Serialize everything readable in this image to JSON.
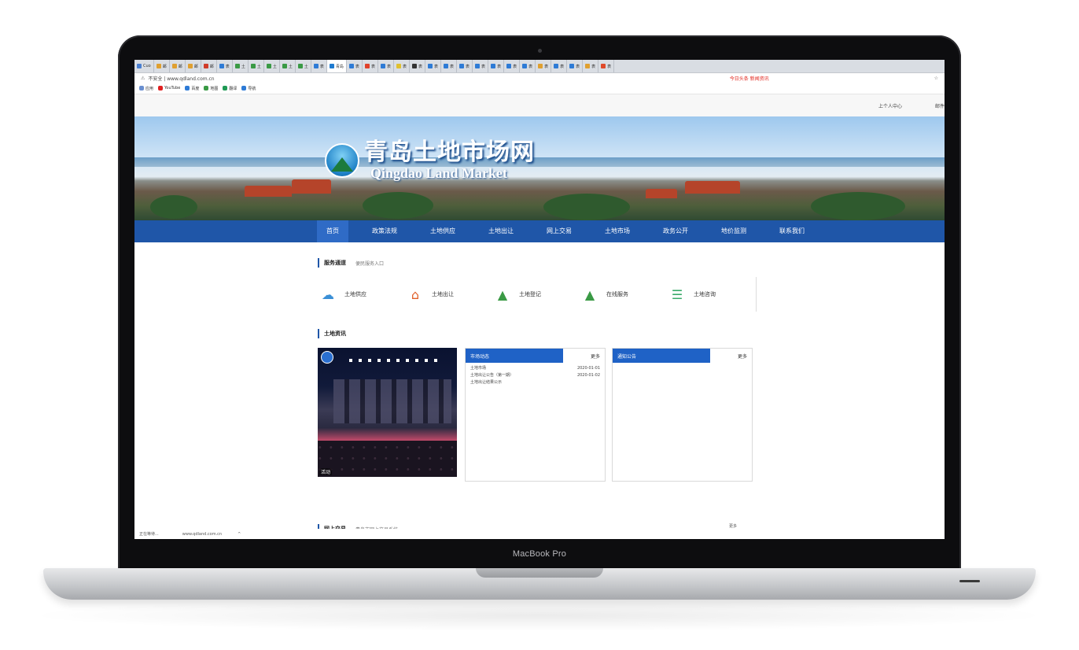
{
  "browser": {
    "tabs": [
      {
        "label": "Cuo",
        "color": "#4a7fd1",
        "active": false
      },
      {
        "label": "邮",
        "color": "#e0a030",
        "active": false
      },
      {
        "label": "邮",
        "color": "#e0a030",
        "active": false
      },
      {
        "label": "邮",
        "color": "#e0a030",
        "active": false
      },
      {
        "label": "邮",
        "color": "#d03b2a",
        "active": false
      },
      {
        "label": "表",
        "color": "#2e7bd6",
        "active": false
      },
      {
        "label": "土",
        "color": "#3a9a45",
        "active": false
      },
      {
        "label": "土",
        "color": "#3a9a45",
        "active": false
      },
      {
        "label": "土",
        "color": "#3a9a45",
        "active": false
      },
      {
        "label": "土",
        "color": "#3a9a45",
        "active": false
      },
      {
        "label": "土",
        "color": "#3a9a45",
        "active": false
      },
      {
        "label": "表",
        "color": "#2e7bd6",
        "active": false
      },
      {
        "label": "青岛",
        "color": "#1f7bd0",
        "active": true
      },
      {
        "label": "表",
        "color": "#2e7bd6",
        "active": false
      },
      {
        "label": "表",
        "color": "#e0412a",
        "active": false
      },
      {
        "label": "表",
        "color": "#2e7bd6",
        "active": false
      },
      {
        "label": "表",
        "color": "#e0c030",
        "active": false
      },
      {
        "label": "表",
        "color": "#333333",
        "active": false
      },
      {
        "label": "表",
        "color": "#2e7bd6",
        "active": false
      },
      {
        "label": "表",
        "color": "#2e7bd6",
        "active": false
      },
      {
        "label": "表",
        "color": "#2e7bd6",
        "active": false
      },
      {
        "label": "表",
        "color": "#2e7bd6",
        "active": false
      },
      {
        "label": "表",
        "color": "#2e7bd6",
        "active": false
      },
      {
        "label": "表",
        "color": "#2e7bd6",
        "active": false
      },
      {
        "label": "表",
        "color": "#2e7bd6",
        "active": false
      },
      {
        "label": "表",
        "color": "#e0a030",
        "active": false
      },
      {
        "label": "表",
        "color": "#2e7bd6",
        "active": false
      },
      {
        "label": "表",
        "color": "#2e7bd6",
        "active": false
      },
      {
        "label": "表",
        "color": "#e0a030",
        "active": false
      },
      {
        "label": "表",
        "color": "#e04a2a",
        "active": false
      }
    ],
    "address": {
      "lock_icon": "lock-icon",
      "url": "不安全 | www.qdland.com.cn",
      "extension_text": "今日头条 新闻资讯",
      "right_text": "☆"
    },
    "bookmarks": [
      {
        "label": "应用",
        "color": "#6a8fd0"
      },
      {
        "label": "YouTube",
        "color": "#e02020"
      },
      {
        "label": "百度",
        "color": "#2e7bd6"
      },
      {
        "label": "地图",
        "color": "#3a9a45"
      },
      {
        "label": "翻译",
        "color": "#1f9a55"
      },
      {
        "label": "导航",
        "color": "#2e7bd6"
      }
    ]
  },
  "page": {
    "top_links": [
      "上个人中心",
      "邮件"
    ],
    "logo_cn": "青岛土地市场网",
    "logo_en": "Qingdao Land Market",
    "nav": [
      {
        "label": "首页",
        "active": true
      },
      {
        "label": "政策法规",
        "active": false
      },
      {
        "label": "土地供应",
        "active": false
      },
      {
        "label": "土地出让",
        "active": false
      },
      {
        "label": "网上交易",
        "active": false
      },
      {
        "label": "土地市场",
        "active": false
      },
      {
        "label": "政务公开",
        "active": false
      },
      {
        "label": "地价监测",
        "active": false
      },
      {
        "label": "联系我们",
        "active": false
      }
    ],
    "services_section": {
      "title": "服务通道",
      "subtitle": "便民服务入口"
    },
    "services": [
      {
        "label": "土地供应",
        "icon": "cloud-icon",
        "color": "#3a8fd6"
      },
      {
        "label": "土地出让",
        "icon": "house-icon",
        "color": "#e0602a"
      },
      {
        "label": "土地登记",
        "icon": "land-icon",
        "color": "#3a9a45"
      },
      {
        "label": "在线服务",
        "icon": "land-icon",
        "color": "#3a9a45"
      },
      {
        "label": "土地咨询",
        "icon": "document-icon",
        "color": "#3aaa6a"
      }
    ],
    "news_section": {
      "title": "土地资讯"
    },
    "photo_caption": "活动",
    "panel_left": {
      "title": "市场动态",
      "more": "更多",
      "rows": [
        {
          "title": "土地市场",
          "date": "2020-01-01"
        },
        {
          "title": "土地出让公告（第一期）",
          "date": "2020-01-02"
        },
        {
          "title": "土地出让结果公示",
          "date": ""
        }
      ]
    },
    "panel_right": {
      "title": "通知公告",
      "more": "更多",
      "rows": []
    },
    "bottom_section": {
      "title": "网上交易",
      "subtitle": "青岛市网上交易系统",
      "more": "更多"
    },
    "status": [
      "正在等待...",
      "www.qdland.com.cn",
      "^"
    ]
  },
  "device": {
    "brand": "MacBook Pro"
  }
}
